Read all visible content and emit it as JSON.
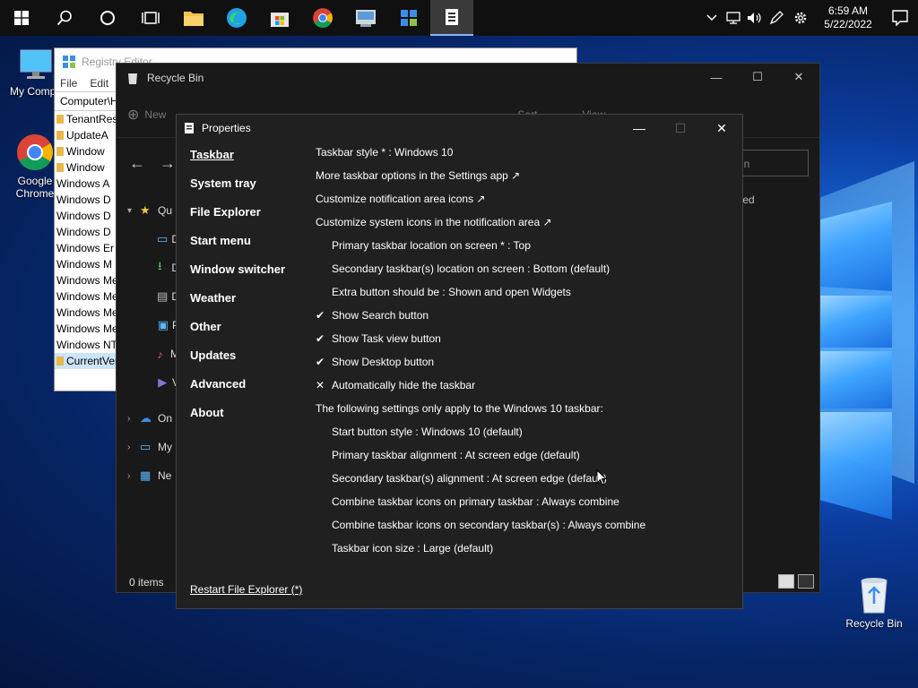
{
  "taskbar": {
    "apps": [
      "start-icon",
      "search-icon",
      "cortana-icon",
      "task-view-icon",
      "file-explorer-icon",
      "edge-icon",
      "store-icon",
      "chrome-icon",
      "control-panel-icon",
      "regedit-icon",
      "explorer-patcher-icon"
    ],
    "clock": {
      "time": "6:59 AM",
      "date": "5/22/2022"
    }
  },
  "desktop": {
    "icons": [
      {
        "label": "My Compu"
      },
      {
        "label_line1": "Google",
        "label_line2": "Chrome"
      },
      {
        "label": "Recycle Bin"
      }
    ]
  },
  "regedit": {
    "title": "Registry Editor",
    "menu": [
      "File",
      "Edit"
    ],
    "address": "Computer\\H",
    "rows": [
      "TenantRest",
      "UpdateA",
      "Window",
      "Window",
      "Windows A",
      "Windows D",
      "Windows D",
      "Windows D",
      "Windows Er",
      "Windows M",
      "Windows Med",
      "Windows Med",
      "Windows Med",
      "Windows Mes",
      "Windows NT",
      "CurrentVers"
    ]
  },
  "recycle_bin": {
    "title": "Recycle Bin",
    "new_label": "New",
    "sort_label": "Sort",
    "view_label": "View",
    "search_placeholder": "in",
    "empty_text": "ted",
    "sidebar": [
      "Qu",
      "D",
      "D",
      "D",
      "P",
      "M",
      "V",
      "On",
      "My",
      "Ne"
    ],
    "status": "0 items"
  },
  "properties": {
    "title": "Properties",
    "nav": [
      "Taskbar",
      "System tray",
      "File Explorer",
      "Start menu",
      "Window switcher",
      "Weather",
      "Other",
      "Updates",
      "Advanced",
      "About"
    ],
    "options": [
      {
        "text": "Taskbar style * : Windows 10",
        "indent": false,
        "mark": ""
      },
      {
        "text": "More taskbar options in the Settings app ↗",
        "indent": false,
        "mark": ""
      },
      {
        "text": "Customize notification area icons ↗",
        "indent": false,
        "mark": ""
      },
      {
        "text": "Customize system icons in the notification area ↗",
        "indent": false,
        "mark": ""
      },
      {
        "text": "Primary taskbar location on screen * : Top",
        "indent": true,
        "mark": ""
      },
      {
        "text": "Secondary taskbar(s) location on screen : Bottom (default)",
        "indent": true,
        "mark": ""
      },
      {
        "text": "Extra button should be : Shown and open Widgets",
        "indent": true,
        "mark": ""
      },
      {
        "text": "Show Search button",
        "indent": true,
        "mark": "✔"
      },
      {
        "text": "Show Task view button",
        "indent": true,
        "mark": "✔"
      },
      {
        "text": "Show Desktop button",
        "indent": true,
        "mark": "✔"
      },
      {
        "text": "Automatically hide the taskbar",
        "indent": true,
        "mark": "✕"
      },
      {
        "text": "The following settings only apply to the Windows 10 taskbar:",
        "indent": false,
        "mark": ""
      },
      {
        "text": "Start button style : Windows 10 (default)",
        "indent": true,
        "mark": ""
      },
      {
        "text": "Primary taskbar alignment : At screen edge (default)",
        "indent": true,
        "mark": ""
      },
      {
        "text": "Secondary taskbar(s) alignment : At screen edge (default)",
        "indent": true,
        "mark": ""
      },
      {
        "text": "Combine taskbar icons on primary taskbar : Always combine",
        "indent": true,
        "mark": ""
      },
      {
        "text": "Combine taskbar icons on secondary taskbar(s) : Always combine",
        "indent": true,
        "mark": ""
      },
      {
        "text": "Taskbar icon size : Large (default)",
        "indent": true,
        "mark": ""
      }
    ],
    "restart": "Restart File Explorer (*)"
  },
  "colors": {
    "taskbar": "#101010",
    "dialog": "#202020",
    "accent": "#8ab4f8"
  }
}
